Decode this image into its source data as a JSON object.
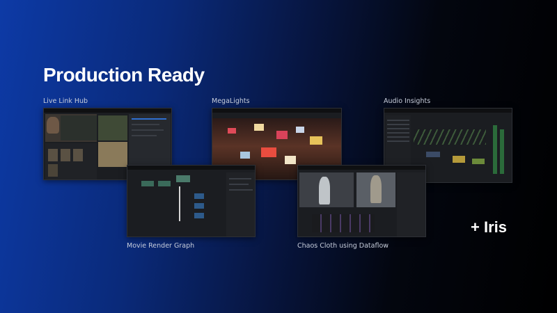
{
  "heading": "Production Ready",
  "features": {
    "live_link_hub": "Live Link Hub",
    "megalights": "MegaLights",
    "audio_insights": "Audio Insights",
    "movie_render_graph": "Movie Render Graph",
    "chaos_cloth": "Chaos Cloth using Dataflow"
  },
  "extra": "+ Iris",
  "colors": {
    "gradient_left": "#0d3aa6",
    "gradient_right": "#000000",
    "text": "#ffffff"
  }
}
